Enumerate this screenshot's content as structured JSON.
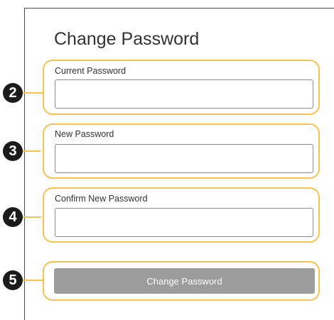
{
  "page": {
    "title": "Change Password"
  },
  "form": {
    "fields": [
      {
        "marker": "2",
        "label": "Current Password",
        "value": ""
      },
      {
        "marker": "3",
        "label": "New Password",
        "value": ""
      },
      {
        "marker": "4",
        "label": "Confirm New Password",
        "value": ""
      }
    ],
    "submit": {
      "marker": "5",
      "label": "Change Password"
    }
  },
  "colors": {
    "callout_border": "#f4c255",
    "marker_fill": "#1b1b1b",
    "button_disabled": "#9c9c9c"
  }
}
